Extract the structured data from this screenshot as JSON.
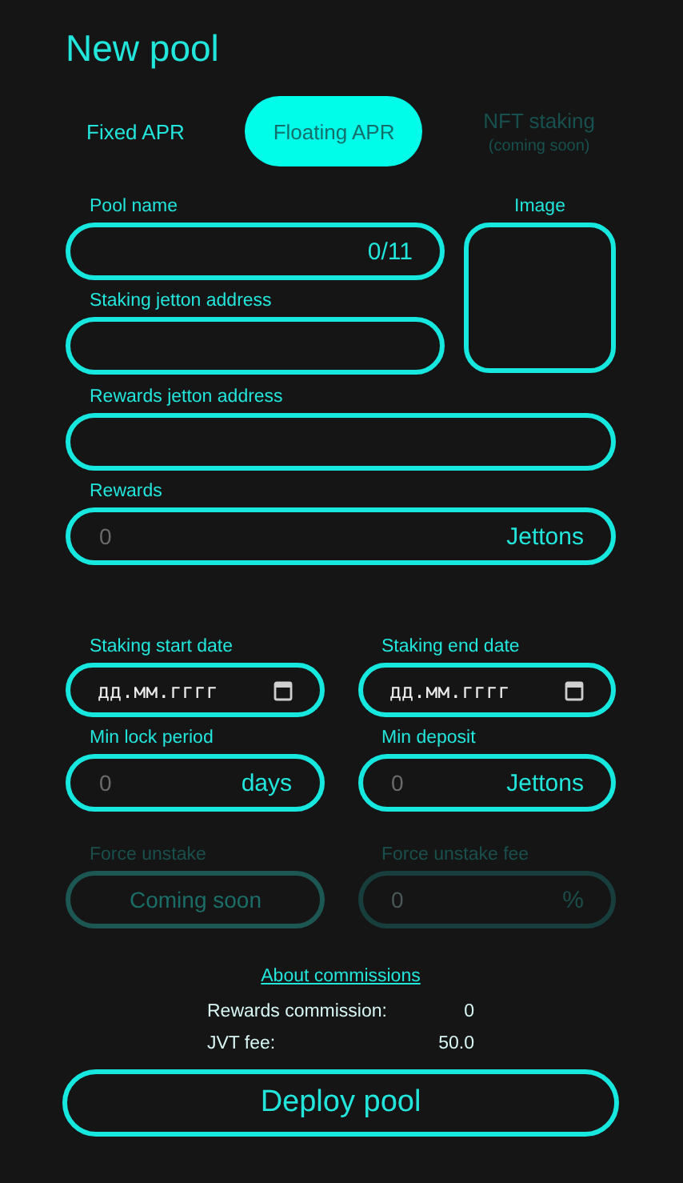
{
  "title": "New pool",
  "tabs": [
    {
      "label": "Fixed APR",
      "selected": false,
      "disabled": false
    },
    {
      "label": "Floating APR",
      "selected": true,
      "disabled": false
    },
    {
      "label": "NFT staking",
      "note": "(coming soon)",
      "selected": false,
      "disabled": true
    }
  ],
  "top": {
    "fields": [
      {
        "label": "Pool name",
        "suffix": "0/11",
        "disabled": false
      },
      {
        "label": "Staking jetton address",
        "disabled": false
      }
    ],
    "image": {
      "label": "Image"
    }
  },
  "sections": [
    [
      [
        {
          "label": "Rewards jetton address",
          "kind": "text",
          "disabled": false
        }
      ],
      [
        {
          "label": "Rewards",
          "kind": "text",
          "placeholder": "0",
          "suffix": "Jettons",
          "disabled": false
        }
      ]
    ],
    [
      [
        {
          "label": "Staking start date",
          "kind": "date",
          "placeholder": "дд.мм.гггг",
          "disabled": false
        },
        {
          "label": "Staking end date",
          "kind": "date",
          "placeholder": "дд.мм.гггг",
          "disabled": false
        }
      ],
      [
        {
          "label": "Min lock period",
          "kind": "text",
          "placeholder": "0",
          "suffix": "days",
          "disabled": false
        },
        {
          "label": "Min deposit",
          "kind": "text",
          "placeholder": "0",
          "suffix": "Jettons",
          "disabled": false
        }
      ],
      [
        {
          "label": "Force unstake",
          "kind": "static",
          "text": "Coming soon",
          "disabled": true
        },
        {
          "label": "Force unstake fee",
          "kind": "text",
          "placeholder": "0",
          "suffix": "%",
          "disabled": true
        }
      ]
    ]
  ],
  "commissions": {
    "link": "About commissions",
    "items": [
      {
        "label": "Rewards commission:",
        "value": "0"
      },
      {
        "label": "JVT fee:",
        "value": "50.0"
      }
    ]
  },
  "button": "Deploy pool"
}
